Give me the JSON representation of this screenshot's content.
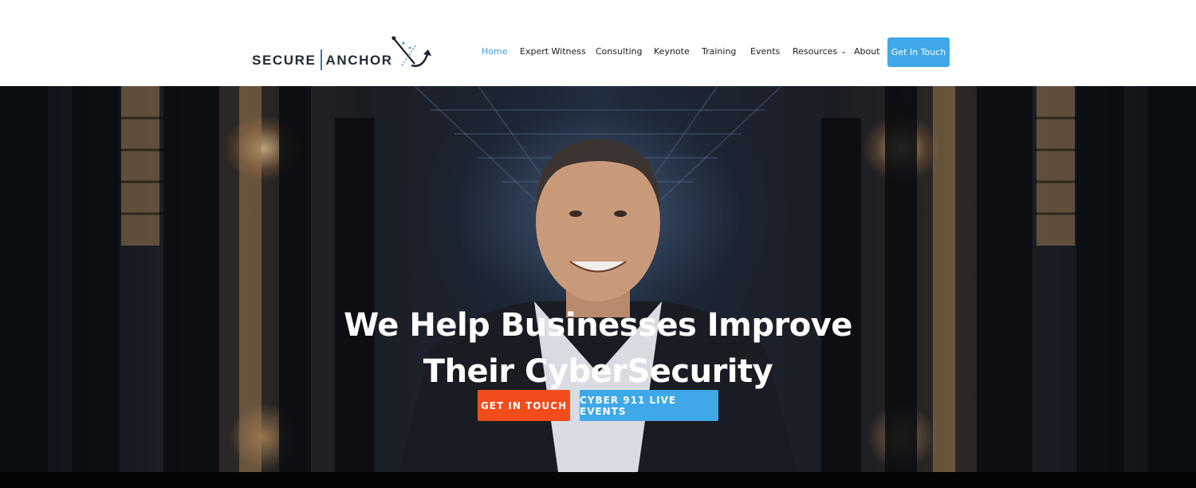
{
  "header": {
    "logo": {
      "text_left": "SECURE",
      "text_right": "ANCHOR"
    },
    "nav": [
      {
        "label": "Home",
        "active": true
      },
      {
        "label": "Expert Witness",
        "active": false
      },
      {
        "label": "Consulting",
        "active": false
      },
      {
        "label": "Keynote",
        "active": false
      },
      {
        "label": "Training",
        "active": false
      },
      {
        "label": "Events",
        "active": false
      },
      {
        "label": "Resources",
        "active": false,
        "has_dropdown": true
      },
      {
        "label": "About",
        "active": false
      }
    ],
    "cta_label": "Get In Touch"
  },
  "hero": {
    "headline_line1": "We Help Businesses Improve",
    "headline_line2": "Their CyberSecurity",
    "button_primary": "GET IN TOUCH",
    "button_secondary": "CYBER 911 LIVE EVENTS"
  },
  "colors": {
    "accent_blue": "#3ea8e8",
    "accent_orange": "#f24c1c",
    "nav_active": "#3f9fd8",
    "logo_dark": "#222a36"
  },
  "icons": {
    "logo_mark": "anchor-satellite-icon",
    "dropdown": "chevron-down-icon"
  }
}
